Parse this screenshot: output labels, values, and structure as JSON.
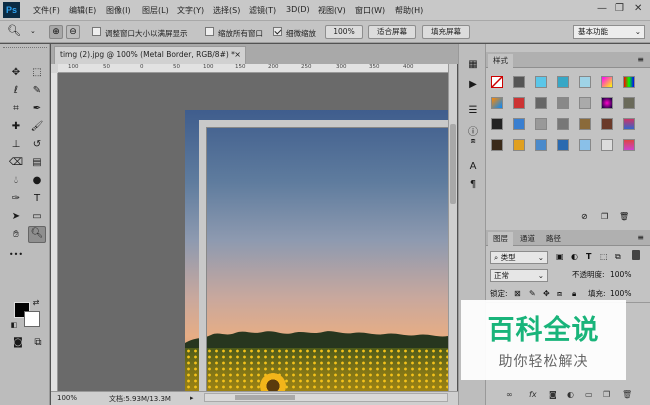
{
  "app": {
    "logo": "Ps"
  },
  "menu": {
    "items": [
      "文件(F)",
      "编辑(E)",
      "图像(I)",
      "图层(L)",
      "文字(Y)",
      "选择(S)",
      "滤镜(T)",
      "3D(D)",
      "视图(V)",
      "窗口(W)",
      "帮助(H)"
    ]
  },
  "window_controls": {
    "minimize": "—",
    "restore": "❐",
    "close": "✕"
  },
  "options": {
    "resize_window": "调整窗口大小以满屏显示",
    "zoom_all": "缩放所有窗口",
    "scrubby_zoom": "细微缩放",
    "zoom_value": "100%",
    "fit_screen": "适合屏幕",
    "fill_screen": "填充屏幕",
    "workspace": "基本功能"
  },
  "document": {
    "tab_title": "timg (2).jpg @ 100% (Metal Border, RGB/8#) *",
    "close": "×",
    "ruler_marks": [
      "100",
      "50",
      "0",
      "50",
      "100",
      "150",
      "200",
      "250",
      "300",
      "350",
      "400"
    ]
  },
  "status": {
    "zoom": "100%",
    "doc_size": "文档:5.93M/13.3M",
    "arrow": "▸"
  },
  "styles_panel": {
    "title": "样式"
  },
  "layers_panel": {
    "tabs": [
      "图层",
      "通道",
      "路径"
    ],
    "filter_kind": "类型",
    "blend_mode": "正常",
    "opacity_label": "不透明度:",
    "opacity_value": "100%",
    "lock_label": "锁定:",
    "fill_label": "填充:",
    "fill_value": "100%"
  },
  "watermark": {
    "title": "百科全说",
    "subtitle": "助你轻松解决"
  }
}
